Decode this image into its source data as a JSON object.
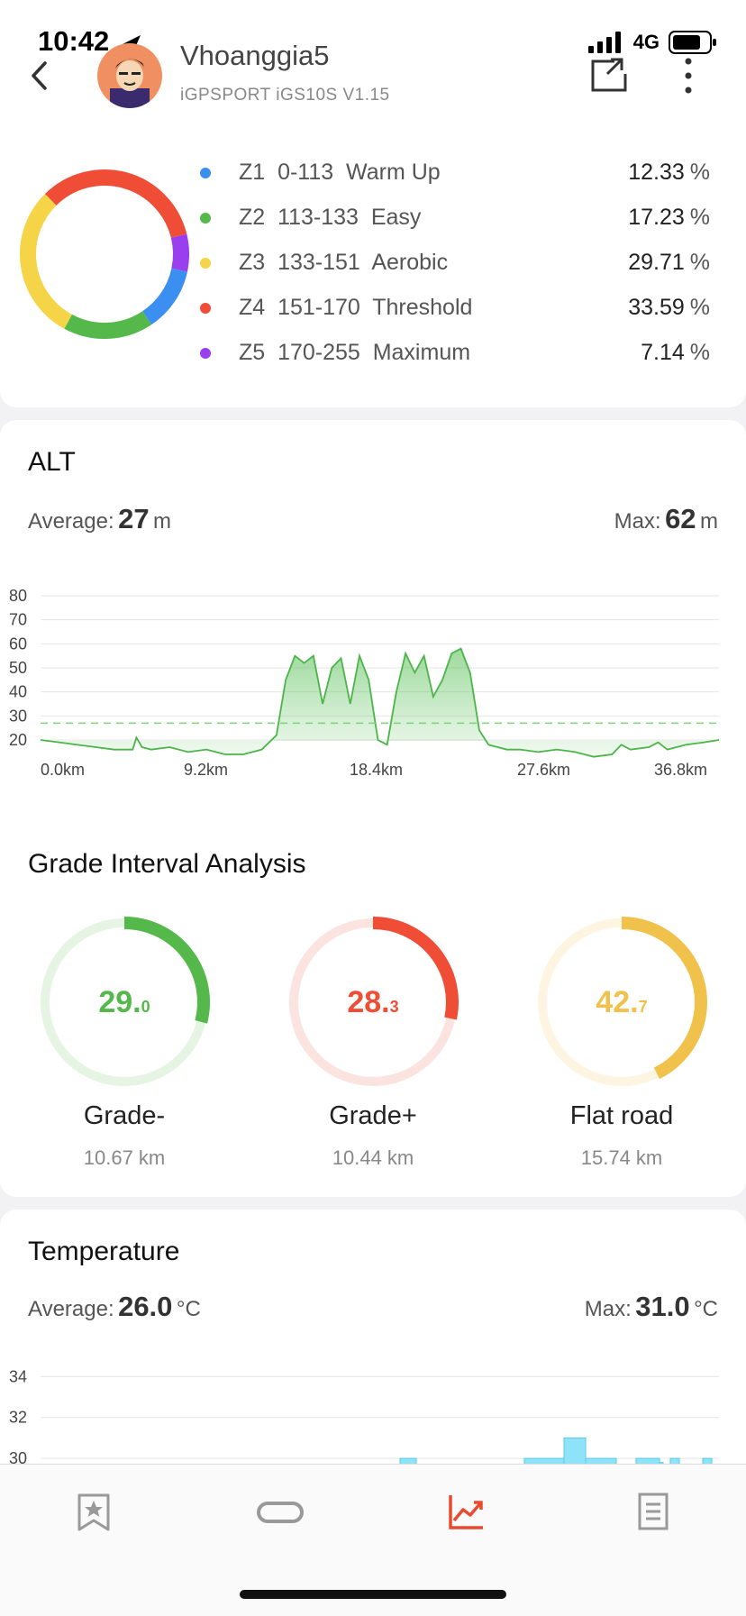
{
  "status": {
    "time": "10:42",
    "network": "4G"
  },
  "header": {
    "name": "Vhoanggia5",
    "device": "iGPSPORT iGS10S V1.15"
  },
  "zones": [
    {
      "label": "Z1  0-113  Warm Up",
      "pct": "12.33",
      "unit": "%",
      "color": "#3b8ff0"
    },
    {
      "label": "Z2  113-133  Easy",
      "pct": "17.23",
      "unit": "%",
      "color": "#55b84a"
    },
    {
      "label": "Z3  133-151  Aerobic",
      "pct": "29.71",
      "unit": "%",
      "color": "#f5d547"
    },
    {
      "label": "Z4  151-170  Threshold",
      "pct": "33.59",
      "unit": "%",
      "color": "#ef4d36"
    },
    {
      "label": "Z5  170-255  Maximum",
      "pct": "7.14",
      "unit": "%",
      "color": "#9a3ff0"
    }
  ],
  "alt": {
    "title": "ALT",
    "avg_label": "Average:",
    "avg_value": "27",
    "avg_unit": "m",
    "max_label": "Max:",
    "max_value": "62",
    "max_unit": "m"
  },
  "chart_data": [
    {
      "type": "area",
      "title": "ALT",
      "x_ticks": [
        "0.0km",
        "9.2km",
        "18.4km",
        "27.6km",
        "36.8km"
      ],
      "y_ticks": [
        "20",
        "30",
        "40",
        "50",
        "60",
        "70",
        "80"
      ],
      "ylim": [
        20,
        80
      ],
      "xlim": [
        0,
        36.8
      ],
      "average": 27,
      "series": [
        {
          "x": [
            0,
            1,
            2,
            3,
            4,
            5,
            5.2,
            5.5,
            6,
            7,
            8,
            9,
            10,
            11,
            12,
            12.8,
            13.3,
            13.8,
            14.3,
            14.8,
            15.3,
            15.8,
            16.3,
            16.8,
            17.3,
            17.8,
            18.3,
            18.8,
            19.3,
            19.8,
            20.3,
            20.8,
            21.3,
            21.8,
            22.3,
            22.8,
            23.3,
            23.8,
            24.3,
            24.8,
            25.3,
            26,
            27,
            28,
            29,
            30,
            31,
            31.5,
            32,
            33,
            33.5,
            34,
            35,
            36,
            36.8
          ],
          "y": [
            20,
            19,
            18,
            17,
            16,
            16,
            21,
            17,
            16,
            17,
            15,
            16,
            14,
            14,
            16,
            22,
            45,
            55,
            52,
            55,
            35,
            50,
            54,
            35,
            55,
            45,
            20,
            18,
            40,
            56,
            48,
            55,
            38,
            45,
            56,
            58,
            48,
            24,
            18,
            17,
            16,
            16,
            15,
            16,
            15,
            13,
            14,
            18,
            16,
            17,
            19,
            16,
            18,
            19,
            20
          ]
        }
      ]
    },
    {
      "type": "bar",
      "title": "Temperature",
      "y_ticks": [
        "30",
        "32",
        "34"
      ],
      "ylim": [
        29.3,
        34.5
      ]
    }
  ],
  "grade": {
    "title": "Grade Interval Analysis",
    "items": [
      {
        "value_int": "29.",
        "value_dec": "0",
        "name": "Grade-",
        "km": "10.67 km",
        "color": "#55b84a",
        "track": "#e6f4e3",
        "fraction": 0.29
      },
      {
        "value_int": "28.",
        "value_dec": "3",
        "name": "Grade+",
        "km": "10.44 km",
        "color": "#ef4d36",
        "track": "#fbe3df",
        "fraction": 0.283
      },
      {
        "value_int": "42.",
        "value_dec": "7",
        "name": "Flat road",
        "km": "15.74 km",
        "color": "#f0c24b",
        "track": "#fdf5e2",
        "fraction": 0.427
      }
    ]
  },
  "temperature": {
    "title": "Temperature",
    "avg_label": "Average:",
    "avg_value": "26.0",
    "avg_unit": "°C",
    "max_label": "Max:",
    "max_value": "31.0",
    "max_unit": "°C"
  },
  "tabs": [
    "bookmark-star-icon",
    "link-icon",
    "trend-chart-icon",
    "report-icon"
  ],
  "active_color": "#e9492f"
}
